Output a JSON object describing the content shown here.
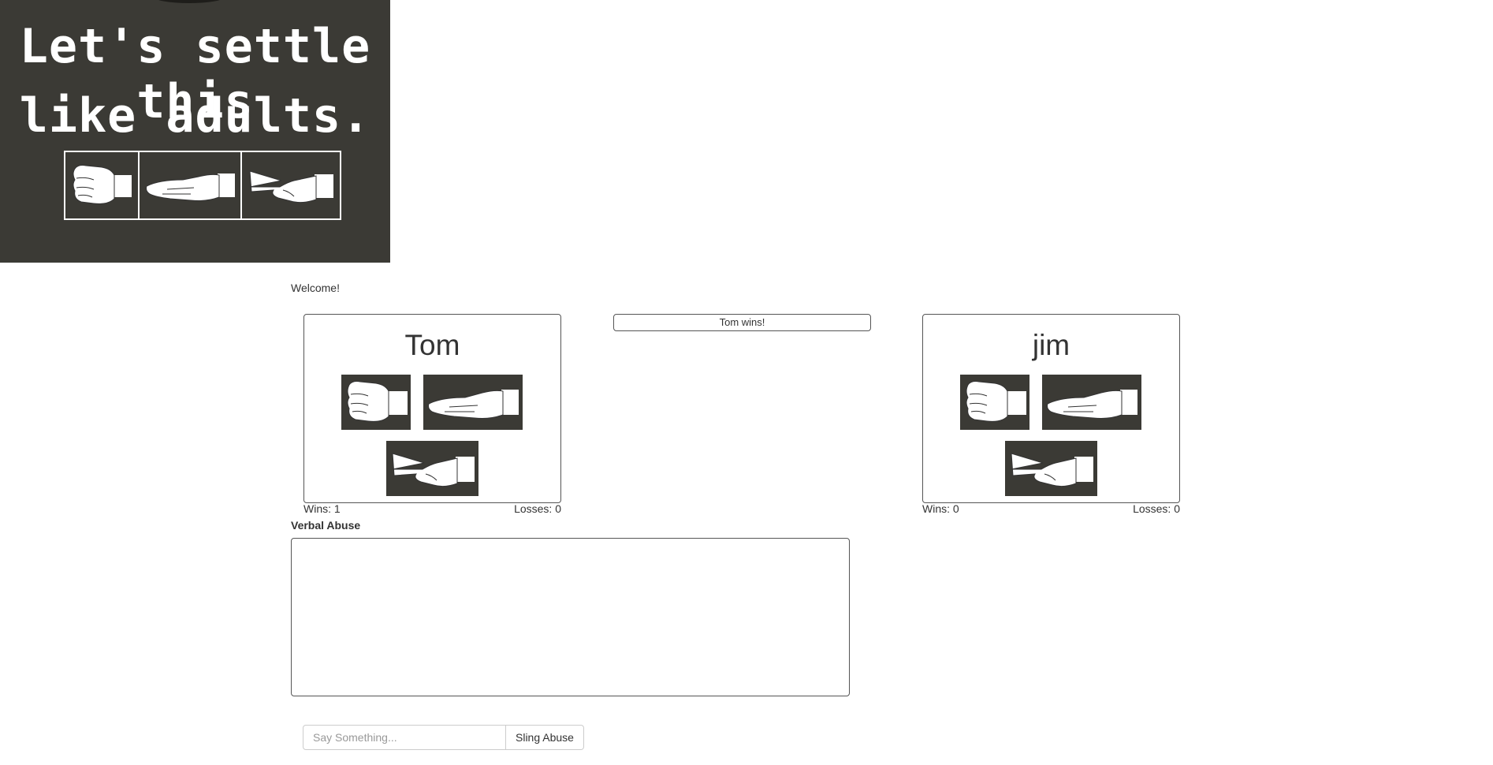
{
  "banner": {
    "line1": "Let's settle this",
    "line2": "like adults.",
    "hands": [
      "rock-hand-icon",
      "paper-hand-icon",
      "scissors-hand-icon"
    ]
  },
  "welcome_text": "Welcome!",
  "result_text": "Tom wins!",
  "players": [
    {
      "name": "Tom",
      "wins_label": "Wins: 1",
      "losses_label": "Losses: 0"
    },
    {
      "name": "jim",
      "wins_label": "Wins: 0",
      "losses_label": "Losses: 0"
    }
  ],
  "chat": {
    "label": "Verbal Abuse",
    "placeholder": "Say Something...",
    "send_label": "Sling Abuse"
  },
  "colors": {
    "banner_bg": "#3b3a35",
    "border": "#555555"
  }
}
